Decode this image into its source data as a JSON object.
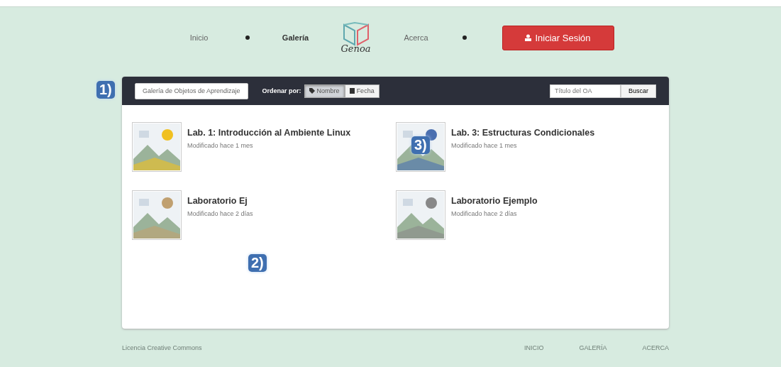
{
  "nav": {
    "links": [
      {
        "label": "Inicio",
        "selected": false
      },
      {
        "label": "Galería",
        "selected": true
      },
      {
        "label": "Acerca",
        "selected": false
      }
    ],
    "logo": "Genoa",
    "login_button": "Iniciar Sesión"
  },
  "toolbar": {
    "gallery_field": "Galería de Objetos de Aprendizaje",
    "sort_label": "Ordenar por:",
    "sort_options": [
      {
        "label": "Nombre",
        "selected": true
      },
      {
        "label": "Fecha",
        "selected": false
      }
    ],
    "search": {
      "placeholder": "Título del OA"
    },
    "search_button": "Buscar"
  },
  "items": [
    {
      "title": "Lab. 1: Introducción al Ambiente Linux",
      "modified": "Modificado hace 1 mes"
    },
    {
      "title": "Lab. 3: Estructuras Condicionales",
      "modified": "Modificado hace 1 mes"
    },
    {
      "title": "Laboratorio Ej",
      "modified": "Modificado hace 2 días"
    },
    {
      "title": "Laboratorio Ejemplo",
      "modified": "Modificado hace 2 días"
    }
  ],
  "callouts": [
    {
      "label": "1)"
    },
    {
      "label": "2)"
    },
    {
      "label": "3)"
    }
  ],
  "footer": {
    "license": "Licencia Creative Commons",
    "links": [
      "INICIO",
      "GALERÍA",
      "ACERCA"
    ]
  }
}
